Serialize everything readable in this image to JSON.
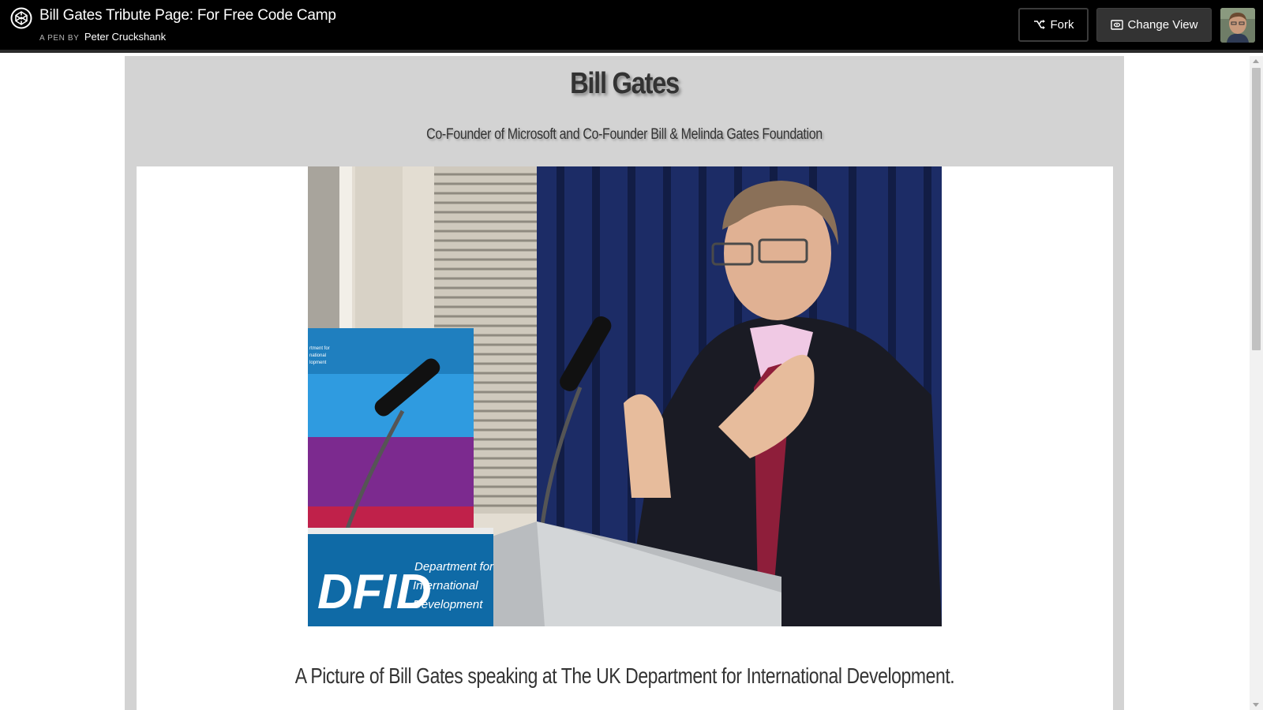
{
  "header": {
    "title": "Bill Gates Tribute Page: For Free Code Camp",
    "by_label": "A PEN BY",
    "author": "Peter Cruckshank",
    "fork_label": "Fork",
    "change_view_label": "Change View"
  },
  "page": {
    "name": "Bill Gates",
    "subtitle": "Co-Founder of Microsoft and Co-Founder Bill & Melinda Gates Foundation",
    "image_caption": "A Picture of Bill Gates speaking at The UK Department for International Development.",
    "podium_sign": {
      "abbrev": "DFID",
      "line1": "Department for",
      "line2": "International",
      "line3": "Development"
    },
    "banner_text": {
      "line1": "rtment for",
      "line2": "national",
      "line3": "lopment"
    }
  },
  "colors": {
    "topbar": "#000000",
    "page_background": "#d3d3d3",
    "image_panel": "#ffffff",
    "text": "#333333"
  }
}
